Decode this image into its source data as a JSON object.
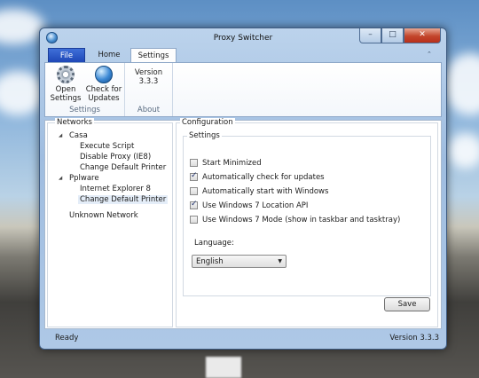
{
  "window": {
    "title": "Proxy Switcher",
    "minimize_glyph": "–",
    "maximize_glyph": "□",
    "close_glyph": "✕"
  },
  "menu_tabs": {
    "file": "File",
    "home": "Home",
    "settings": "Settings"
  },
  "ribbon": {
    "open_settings": {
      "line1": "Open",
      "line2": "Settings",
      "icon": "gear-icon"
    },
    "check_updates": {
      "line1": "Check for",
      "line2": "Updates",
      "icon": "globe-icon"
    },
    "settings_group_caption": "Settings",
    "version": "Version 3.3.3",
    "about_group_caption": "About"
  },
  "networks": {
    "legend": "Networks",
    "groups": [
      {
        "name": "Casa",
        "items": [
          "Execute Script",
          "Disable Proxy (IE8)",
          "Change Default Printer"
        ]
      },
      {
        "name": "Pplware",
        "items": [
          "Internet Explorer 8",
          "Change Default Printer"
        ]
      }
    ],
    "unknown": "Unknown Network",
    "selected_item": "Change Default Printer"
  },
  "configuration": {
    "legend": "Configuration",
    "settings_legend": "Settings",
    "options": [
      {
        "label": "Start Minimized",
        "checked": false
      },
      {
        "label": "Automatically check for updates",
        "checked": true
      },
      {
        "label": "Automatically start with Windows",
        "checked": false
      },
      {
        "label": "Use Windows 7 Location API",
        "checked": true
      },
      {
        "label": "Use Windows 7 Mode (show in taskbar and tasktray)",
        "checked": false
      }
    ],
    "language_label": "Language:",
    "language_value": "English",
    "save_label": "Save"
  },
  "status": {
    "left": "Ready",
    "right": "Version 3.3.3"
  },
  "colors": {
    "file_tab": "#1e47b7",
    "close_button": "#c3452c"
  }
}
